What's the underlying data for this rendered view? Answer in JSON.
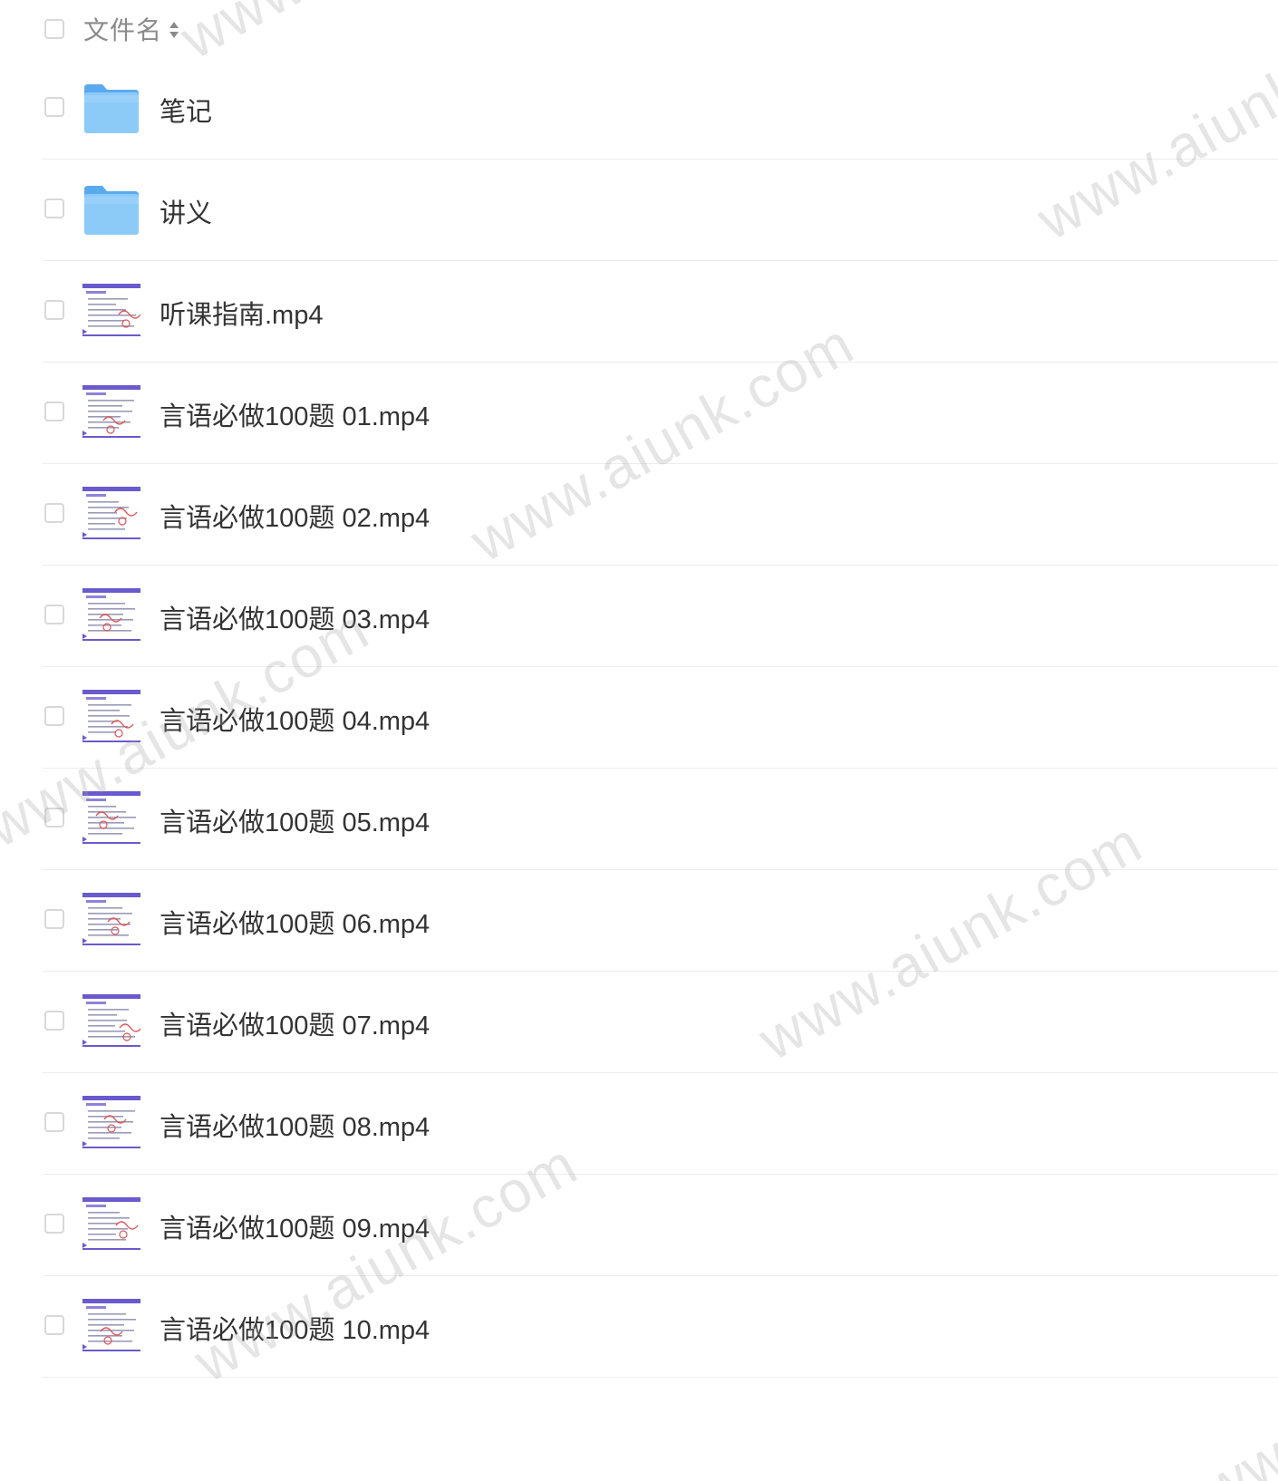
{
  "header": {
    "label": "文件名",
    "sort_icon": "sort-arrows-icon"
  },
  "files": [
    {
      "name": "笔记",
      "icon": "folder-icon",
      "kind": "folder"
    },
    {
      "name": "讲义",
      "icon": "folder-icon",
      "kind": "folder"
    },
    {
      "name": "听课指南.mp4",
      "icon": "video-thumbnail-icon",
      "kind": "video"
    },
    {
      "name": "言语必做100题 01.mp4",
      "icon": "video-thumbnail-icon",
      "kind": "video"
    },
    {
      "name": "言语必做100题 02.mp4",
      "icon": "video-thumbnail-icon",
      "kind": "video"
    },
    {
      "name": "言语必做100题 03.mp4",
      "icon": "video-thumbnail-icon",
      "kind": "video"
    },
    {
      "name": "言语必做100题 04.mp4",
      "icon": "video-thumbnail-icon",
      "kind": "video"
    },
    {
      "name": "言语必做100题 05.mp4",
      "icon": "video-thumbnail-icon",
      "kind": "video"
    },
    {
      "name": "言语必做100题 06.mp4",
      "icon": "video-thumbnail-icon",
      "kind": "video"
    },
    {
      "name": "言语必做100题 07.mp4",
      "icon": "video-thumbnail-icon",
      "kind": "video"
    },
    {
      "name": "言语必做100题 08.mp4",
      "icon": "video-thumbnail-icon",
      "kind": "video"
    },
    {
      "name": "言语必做100题 09.mp4",
      "icon": "video-thumbnail-icon",
      "kind": "video"
    },
    {
      "name": "言语必做100题 10.mp4",
      "icon": "video-thumbnail-icon",
      "kind": "video"
    }
  ],
  "watermark": {
    "text": "www.aiunk.com"
  },
  "colors": {
    "folder": "#6cb8f4",
    "thumbnail_accent": "#6a5acd",
    "thumbnail_ink": "#e05555"
  }
}
